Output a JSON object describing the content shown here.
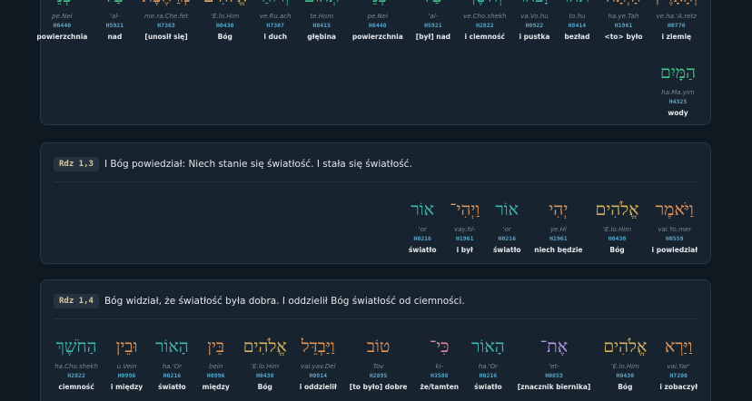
{
  "verses": [
    {
      "ref": "",
      "text": "",
      "words": [
        {
          "heb": "וְהָאָרֶץ",
          "tr": "ve.ha.'A.retz",
          "strong": "H0776",
          "gloss": "i ziemię",
          "color": "c-orange"
        },
        {
          "heb": "הָיְתָה",
          "tr": "ha.ye.Tah",
          "strong": "H1961",
          "gloss": "<to> było",
          "color": "c-orange"
        },
        {
          "heb": "תֹהוּ",
          "tr": "to.hu",
          "strong": "H8414",
          "gloss": "bezład",
          "color": "c-teal"
        },
        {
          "heb": "וָבֹהוּ",
          "tr": "va.Vo.hu",
          "strong": "H0922",
          "gloss": "i pustka",
          "color": "c-teal"
        },
        {
          "heb": "וְחֹשֶׁךְ",
          "tr": "ve.Cho.shekh",
          "strong": "H2822",
          "gloss": "i ciemność",
          "color": "c-teal"
        },
        {
          "heb": "עַל",
          "tr": "'al-",
          "strong": "H5921",
          "gloss": "[był] nad",
          "color": "c-green"
        },
        {
          "heb": "פְּנֵי",
          "tr": "pe.Nei",
          "strong": "H6440",
          "gloss": "powierzchnia",
          "color": "c-green"
        },
        {
          "heb": "תְהוֹם",
          "tr": "te.Hom",
          "strong": "H8415",
          "gloss": "głębina",
          "color": "c-green"
        },
        {
          "heb": "וְרוּחַ",
          "tr": "ve.Ru.ach",
          "strong": "H7307",
          "gloss": "i duch",
          "color": "c-teal"
        },
        {
          "heb": "אֱלֹהִים",
          "tr": "'E.lo.Him",
          "strong": "H0430",
          "gloss": "Bóg",
          "color": "c-gold"
        },
        {
          "heb": "מְרַחֶפֶת",
          "tr": "me.ra.Che.fet",
          "strong": "H7363",
          "gloss": "[unosił się]",
          "color": "c-orange"
        },
        {
          "heb": "עַל",
          "tr": "'al-",
          "strong": "H5921",
          "gloss": "nad",
          "color": "c-green"
        },
        {
          "heb": "פְּנֵי",
          "tr": "pe.Nei",
          "strong": "H6440",
          "gloss": "powierzchnia",
          "color": "c-green"
        }
      ],
      "extra": {
        "heb": "הַמָּיִם",
        "tr": "ha.Ma.yim",
        "strong": "H4325",
        "gloss": "wody",
        "color": "c-green"
      }
    },
    {
      "ref": "Rdz 1,3",
      "text": "I Bóg powiedział: Niech stanie się światłość. I stała się światłość.",
      "words": [
        {
          "heb": "וַיֹּאמֶר",
          "tr": "vai.Yo.mer",
          "strong": "H0559",
          "gloss": "i powiedział",
          "color": "c-orange"
        },
        {
          "heb": "אֱלֹהִים",
          "tr": "'E.lo.Him",
          "strong": "H0430",
          "gloss": "Bóg",
          "color": "c-gold"
        },
        {
          "heb": "יְהִי",
          "tr": "ye.Hi",
          "strong": "H1961",
          "gloss": "niech będzie",
          "color": "c-orange"
        },
        {
          "heb": "אוֹר",
          "tr": "'or",
          "strong": "H0216",
          "gloss": "światło",
          "color": "c-teal"
        },
        {
          "heb": "וַיְהִי־",
          "tr": "vay.hi-",
          "strong": "H1961",
          "gloss": "i był",
          "color": "c-orange"
        },
        {
          "heb": "אוֹר",
          "tr": "'or",
          "strong": "H0216",
          "gloss": "światło",
          "color": "c-teal"
        }
      ]
    },
    {
      "ref": "Rdz 1,4",
      "text": "Bóg widział, że światłość była dobra. I oddzielił Bóg światłość od ciemności.",
      "words": [
        {
          "heb": "וַיַּרְא",
          "tr": "vai.Yar'",
          "strong": "H7200",
          "gloss": "i zobaczył",
          "color": "c-orange"
        },
        {
          "heb": "אֱלֹהִים",
          "tr": "'E.lo.Him",
          "strong": "H0430",
          "gloss": "Bóg",
          "color": "c-gold"
        },
        {
          "heb": "אֶת־",
          "tr": "'et-",
          "strong": "H0853",
          "gloss": "[znacznik biernika]",
          "color": "c-violet"
        },
        {
          "heb": "הָאוֹר",
          "tr": "ha.'Or",
          "strong": "H0216",
          "gloss": "światło",
          "color": "c-teal"
        },
        {
          "heb": "כִּי־",
          "tr": "ki-",
          "strong": "H3588",
          "gloss": "że/tamten",
          "color": "c-pink"
        },
        {
          "heb": "טוֹב",
          "tr": "Tov",
          "strong": "H2895",
          "gloss": "[to było] dobre",
          "color": "c-orange"
        },
        {
          "heb": "וַיַּבְדֵּל",
          "tr": "vai.yav.Del",
          "strong": "H0914",
          "gloss": "i oddzielił",
          "color": "c-orange"
        },
        {
          "heb": "אֱלֹהִים",
          "tr": "'E.lo.Him",
          "strong": "H0430",
          "gloss": "Bóg",
          "color": "c-gold"
        },
        {
          "heb": "בֵּין",
          "tr": "bein",
          "strong": "H0996",
          "gloss": "między",
          "color": "c-orange"
        },
        {
          "heb": "הָאוֹר",
          "tr": "ha.'Or",
          "strong": "H0216",
          "gloss": "światło",
          "color": "c-teal"
        },
        {
          "heb": "וּבֵין",
          "tr": "u.Vein",
          "strong": "H0996",
          "gloss": "i między",
          "color": "c-orange"
        },
        {
          "heb": "הַחֹשֶׁךְ",
          "tr": "ha.Cho.shekh",
          "strong": "H2822",
          "gloss": "ciemność",
          "color": "c-teal"
        }
      ]
    }
  ]
}
